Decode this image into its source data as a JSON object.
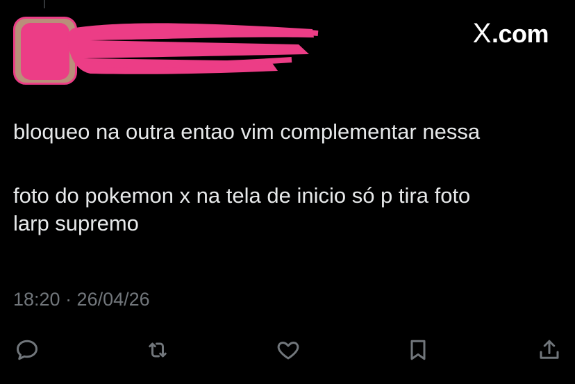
{
  "header": {
    "brand": "X.com"
  },
  "tweet": {
    "lines": [
      "bloqueo na outra entao vim complementar nessa",
      "foto do pokemon x na tela de inicio só p tira foto",
      "larp supremo"
    ],
    "timestamp": "18:20 · 26/04/26"
  },
  "actions": [
    {
      "name": "reply",
      "icon": "reply-icon"
    },
    {
      "name": "repost",
      "icon": "repost-icon"
    },
    {
      "name": "like",
      "icon": "heart-icon"
    },
    {
      "name": "bookmark",
      "icon": "bookmark-icon"
    },
    {
      "name": "share",
      "icon": "share-icon"
    }
  ],
  "colors": {
    "background": "#000000",
    "text": "#e7e9ea",
    "muted": "#71767b",
    "redaction": "#ec3d86"
  }
}
